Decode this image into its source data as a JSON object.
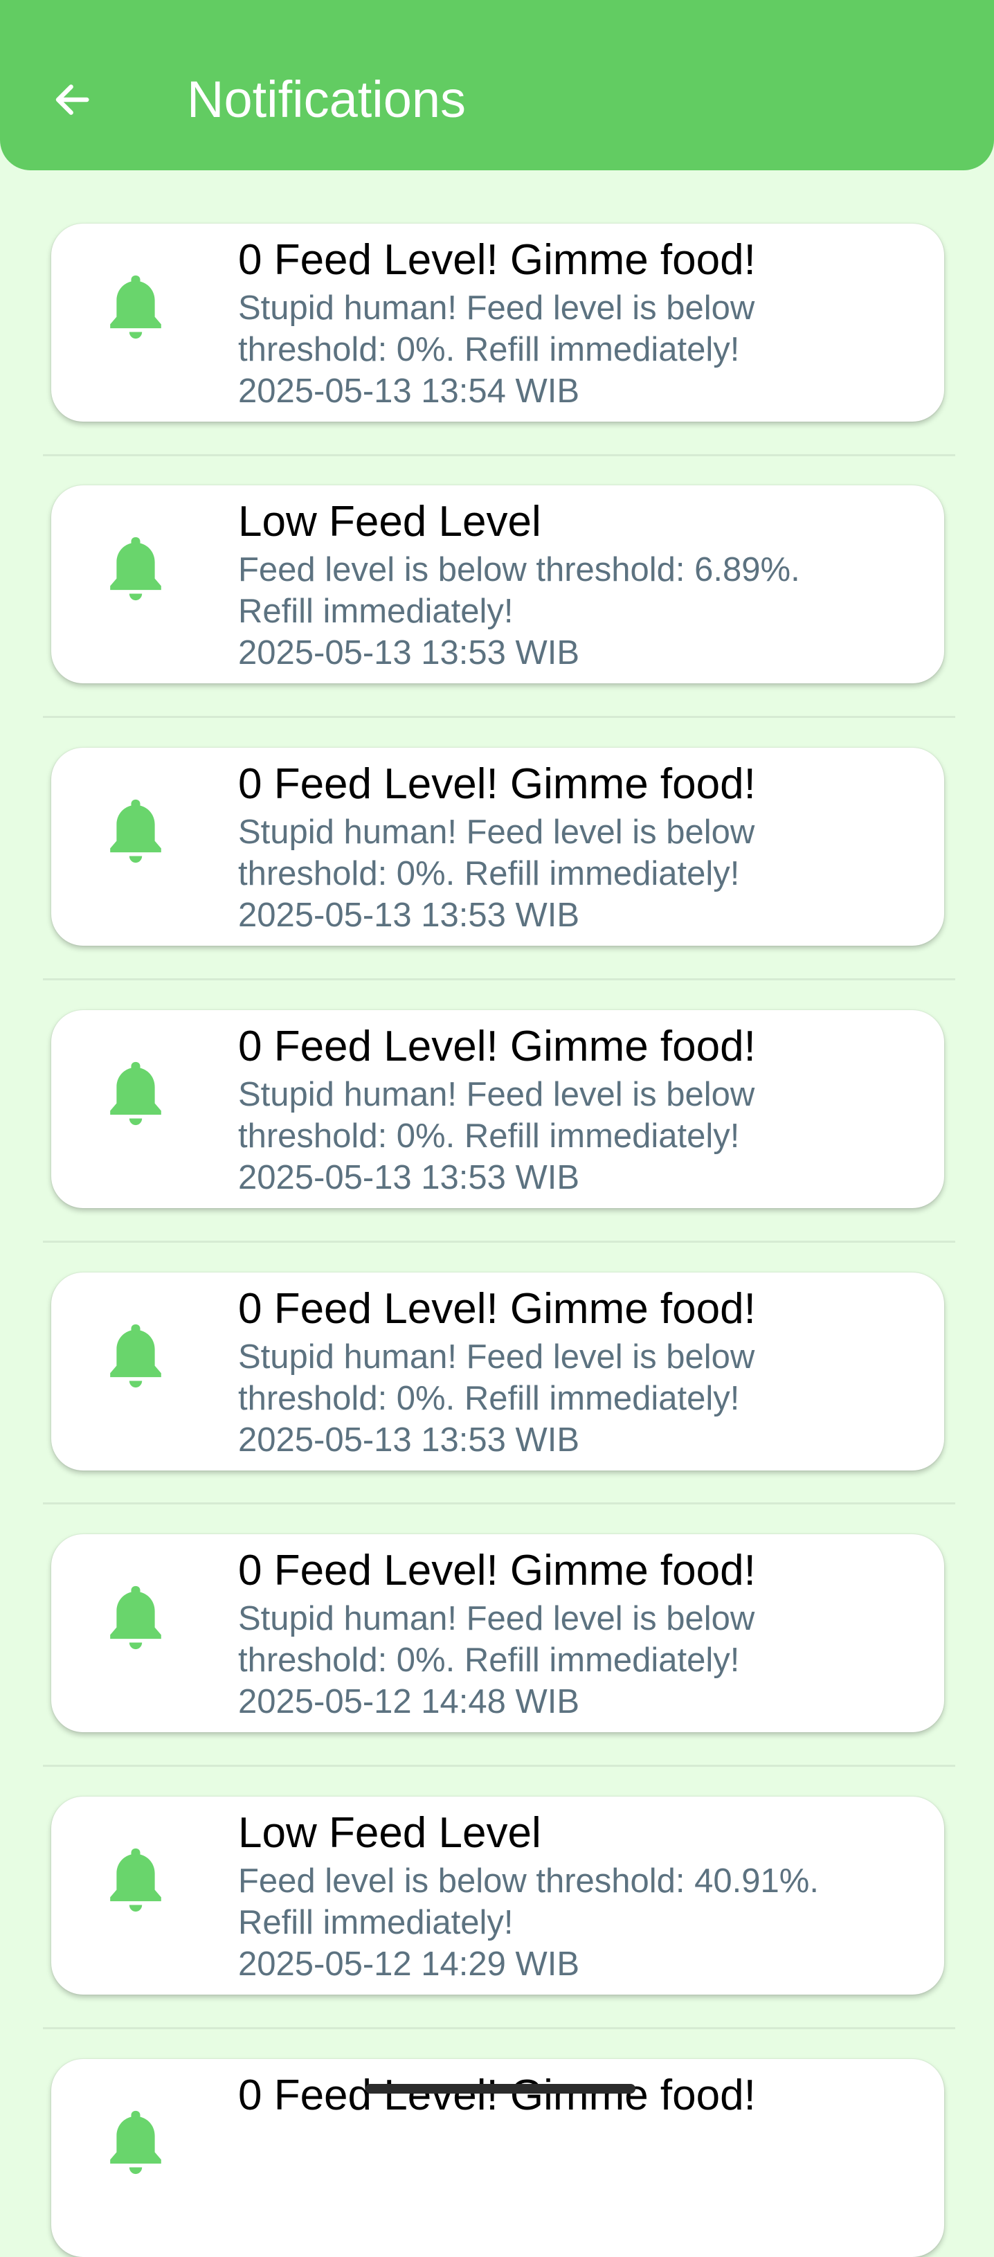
{
  "app_bar": {
    "title": "Notifications",
    "back_icon": "arrow-left-icon",
    "color": "#62cc62"
  },
  "colors": {
    "background": "#e7fde3",
    "bell": "#69d56c",
    "body_text": "#5c7280"
  },
  "notifications": [
    {
      "icon": "bell-icon",
      "title": "0 Feed Level! Gimme food!",
      "body": "Stupid human! Feed level is below\nthreshold: 0%. Refill immediately!",
      "time": "2025-05-13 13:54 WIB"
    },
    {
      "icon": "bell-icon",
      "title": "Low Feed Level",
      "body": "Feed level is below threshold: 6.89%.\nRefill immediately!",
      "time": "2025-05-13 13:53 WIB"
    },
    {
      "icon": "bell-icon",
      "title": "0 Feed Level! Gimme food!",
      "body": "Stupid human! Feed level is below\nthreshold: 0%. Refill immediately!",
      "time": "2025-05-13 13:53 WIB"
    },
    {
      "icon": "bell-icon",
      "title": "0 Feed Level! Gimme food!",
      "body": "Stupid human! Feed level is below\nthreshold: 0%. Refill immediately!",
      "time": "2025-05-13 13:53 WIB"
    },
    {
      "icon": "bell-icon",
      "title": "0 Feed Level! Gimme food!",
      "body": "Stupid human! Feed level is below\nthreshold: 0%. Refill immediately!",
      "time": "2025-05-13 13:53 WIB"
    },
    {
      "icon": "bell-icon",
      "title": "0 Feed Level! Gimme food!",
      "body": "Stupid human! Feed level is below\nthreshold: 0%. Refill immediately!",
      "time": "2025-05-12 14:48 WIB"
    },
    {
      "icon": "bell-icon",
      "title": "Low Feed Level",
      "body": "Feed level is below threshold: 40.91%.\nRefill immediately!",
      "time": "2025-05-12 14:29 WIB"
    },
    {
      "icon": "bell-icon",
      "title": "0 Feed Level! Gimme food!",
      "body": "",
      "time": ""
    }
  ]
}
